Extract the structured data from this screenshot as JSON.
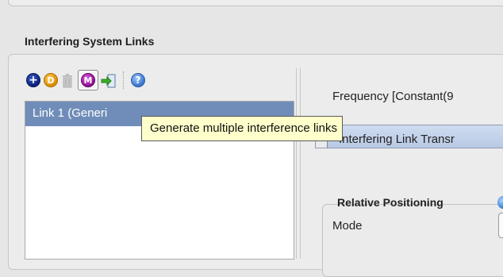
{
  "section": {
    "title": "Interfering System Links"
  },
  "toolbar": {
    "add": {
      "icon": "add-icon",
      "glyph": "+"
    },
    "duplicate": {
      "icon": "duplicate-icon",
      "glyph": "D"
    },
    "delete": {
      "icon": "trash-icon"
    },
    "multiple": {
      "icon": "multiple-links-icon",
      "glyph": "M"
    },
    "import": {
      "icon": "import-icon"
    },
    "help": {
      "icon": "help-icon",
      "glyph": "?"
    }
  },
  "link_list": {
    "items": [
      {
        "label": "Link 1 (Generi"
      }
    ]
  },
  "tooltip": {
    "text": "Generate multiple interference links"
  },
  "right_panel": {
    "frequency_label": "Frequency [Constant(9",
    "transmitter_tab": "Interfering Link Transr",
    "relative_positioning_title": "Relative Positioning",
    "mode_label": "Mode"
  },
  "colors": {
    "selection": "#6f8db8",
    "tooltip_bg": "#ffffcc",
    "panel_bg": "#e6e6e6"
  }
}
